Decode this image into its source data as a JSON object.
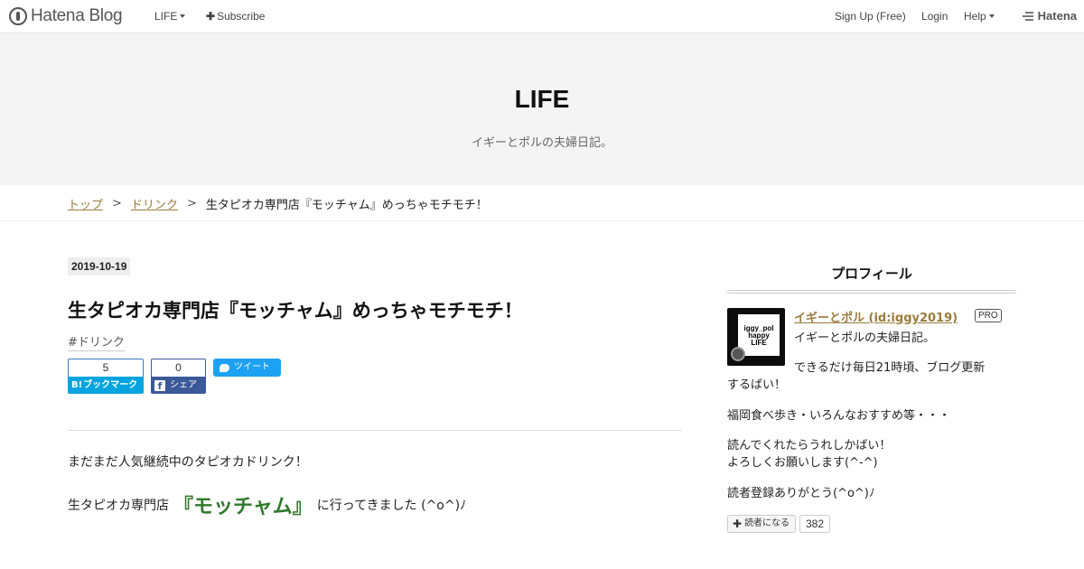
{
  "topbar": {
    "logo_text": "Hatena Blog",
    "blog_menu": "LIFE",
    "subscribe": "Subscribe",
    "signup": "Sign Up (Free)",
    "login": "Login",
    "help": "Help",
    "hatena": "Hatena"
  },
  "header": {
    "title": "LIFE",
    "description": "イギーとポルの夫婦日記。"
  },
  "breadcrumb": {
    "items": [
      "トップ",
      "ドリンク"
    ],
    "separator": ">",
    "current": "生タピオカ専門店『モッチャム』めっちゃモチモチ！"
  },
  "entry": {
    "date": "2019-10-19",
    "title": "生タピオカ専門店『モッチャム』めっちゃモチモチ！",
    "category": "#ドリンク",
    "hatebu": {
      "count": "5",
      "label": "ブックマーク",
      "icon": "B!"
    },
    "facebook": {
      "count": "0",
      "label": "シェア",
      "icon": "f"
    },
    "tweet_label": "ツイート",
    "para1": "まだまだ人気継続中のタピオカドリンク！",
    "para2_before": "生タピオカ専門店",
    "para2_shop": "『モッチャム』",
    "para2_after": "に行ってきました (^o^)ﾉ"
  },
  "sidebar": {
    "heading": "プロフィール",
    "avatar_text": [
      "iggy_pol",
      "happy",
      "LIFE"
    ],
    "name": "イギーとポル (id:iggy2019)",
    "badge": "PRO",
    "lines": [
      "イギーとポルの夫婦日記。",
      "できるだけ毎日21時頃、ブログ更新",
      "するばい！",
      "福岡食べ歩き・いろんなおすすめ等・・・",
      "読んでくれたらうれしかばい！",
      "よろしくお願いします(^-^)",
      "読者登録ありがとう(^o^)ﾉ"
    ],
    "reader_button": "読者になる",
    "reader_count": "382"
  },
  "colors": {
    "link": "#9a7b3d",
    "shop_name": "#2f7a2a",
    "hatebu": "#00a4de",
    "facebook": "#3b5998",
    "twitter": "#1da1f2",
    "header_bg": "#f4f4f4"
  }
}
